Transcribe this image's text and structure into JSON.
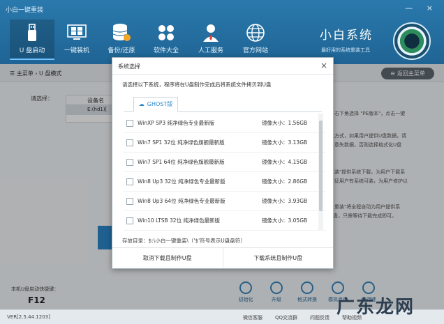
{
  "window": {
    "title": "小白一键重装",
    "controls": "— ×"
  },
  "nav": [
    {
      "label": "U 盘启动",
      "icon": "usb-icon"
    },
    {
      "label": "一键装机",
      "icon": "windows-icon"
    },
    {
      "label": "备份/还原",
      "icon": "database-icon"
    },
    {
      "label": "软件大全",
      "icon": "apps-icon"
    },
    {
      "label": "人工服务",
      "icon": "support-agent-icon"
    },
    {
      "label": "官方网站",
      "icon": "globe-icon"
    }
  ],
  "brand": {
    "name": "小白系统",
    "slogan": "最好用的系统重装工具"
  },
  "breadcrumb": {
    "home": "主菜单",
    "current": "U 盘模式",
    "sep": "›"
  },
  "back_button": "返回主菜单",
  "select_label": "请选择：",
  "device_table": {
    "header": "设备名",
    "row": "E:(hd1)["
  },
  "right_text": [
    "，右下角选择 \"PE版本\"，点击一键",
    "化方式，如果用户提供U盘数据，请",
    "注意失数据，否则选择格式化U盘",
    "重装\"提供系统下载，为用户下载系",
    "保证用户有系统可装，为用户修护以",
    "盘重装\"将全程自动为用户提供系",
    "U盘，只需等待下载完成即可。"
  ],
  "hotkey": {
    "label": "本机U盘启动快捷键：",
    "key": "F12"
  },
  "tools": [
    {
      "label": "初始化",
      "icon": "init-icon"
    },
    {
      "label": "升级",
      "icon": "upgrade-icon"
    },
    {
      "label": "格式转换",
      "icon": "convert-icon"
    },
    {
      "label": "模拟启动",
      "icon": "simulate-icon"
    },
    {
      "label": "快捷键",
      "icon": "shortcut-icon"
    }
  ],
  "footer": {
    "version": "VER[2.5.44.1203]",
    "links": [
      "微信客服",
      "QQ交流群",
      "问题反馈",
      "帮助视频"
    ]
  },
  "watermark": "广东龙网",
  "dialog": {
    "title": "系统选择",
    "description": "请选择以下系统，程序将在U盘制作完成后将系统文件拷贝到U盘",
    "tab": "GHOST版",
    "items": [
      {
        "name": "WinXP SP3  纯净绿色专业最新版",
        "size": "镜像大小：1.56GB"
      },
      {
        "name": "Win7 SP1 32位  纯净绿色旗舰最新版",
        "size": "镜像大小：3.13GB"
      },
      {
        "name": "Win7 SP1 64位  纯净绿色旗舰最新版",
        "size": "镜像大小：4.15GB"
      },
      {
        "name": "Win8 Up3 32位  纯净绿色专业最新版",
        "size": "镜像大小：2.86GB"
      },
      {
        "name": "Win8 Up3 64位  纯净绿色专业最新版",
        "size": "镜像大小：3.93GB"
      },
      {
        "name": "Win10 LTSB 32位  纯净绿色最新版",
        "size": "镜像大小：3.05GB"
      }
    ],
    "save_dir": "存放目录：$:\\小白一键重装\\（'$'符号表示U盘盘符）",
    "cancel_button": "取消下载且制作U盘",
    "confirm_button": "下载系统且制作U盘"
  }
}
